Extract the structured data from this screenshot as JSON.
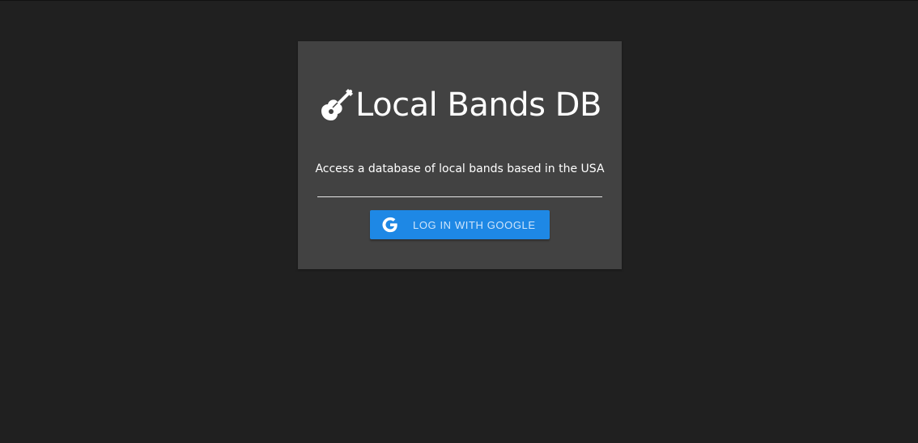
{
  "app": {
    "title": "Local Bands DB",
    "subtitle": "Access a database of local bands based in the USA"
  },
  "login": {
    "button_label": "LOG IN WITH GOOGLE"
  },
  "icons": {
    "logo": "guitar-icon",
    "login": "google-icon"
  },
  "colors": {
    "background": "#202020",
    "card": "#424242",
    "accent": "#1e88e5",
    "text": "#ffffff"
  }
}
